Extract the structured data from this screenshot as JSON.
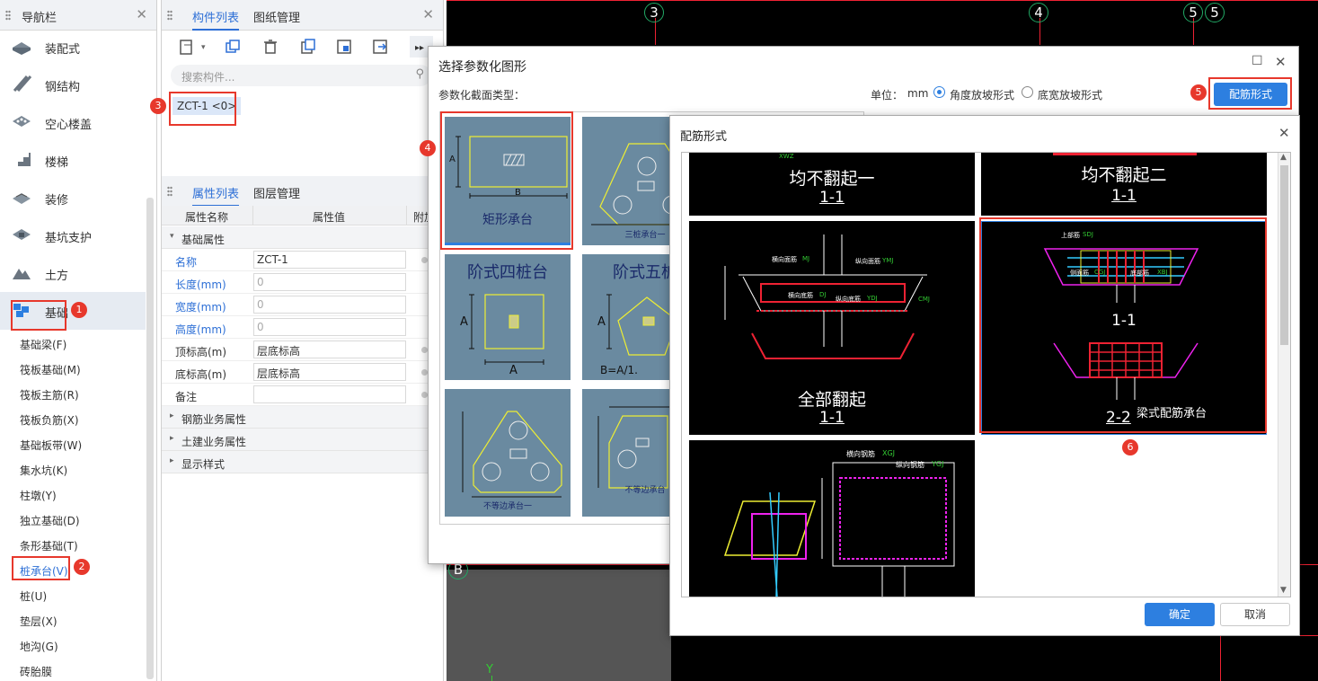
{
  "nav": {
    "title": "导航栏",
    "items": [
      {
        "label": "装配式",
        "icon": "prefab-icon"
      },
      {
        "label": "钢结构",
        "icon": "steel-beam-icon"
      },
      {
        "label": "空心楼盖",
        "icon": "hollow-slab-icon"
      },
      {
        "label": "楼梯",
        "icon": "stairs-icon"
      },
      {
        "label": "装修",
        "icon": "decoration-icon"
      },
      {
        "label": "基坑支护",
        "icon": "pit-support-icon"
      },
      {
        "label": "土方",
        "icon": "earthwork-icon"
      },
      {
        "label": "基础",
        "icon": "foundation-icon"
      }
    ],
    "subitems": [
      "基础梁(F)",
      "筏板基础(M)",
      "筏板主筋(R)",
      "筏板负筋(X)",
      "基础板带(W)",
      "集水坑(K)",
      "柱墩(Y)",
      "独立基础(D)",
      "条形基础(T)",
      "桩承台(V)",
      "桩(U)",
      "垫层(X)",
      "地沟(G)",
      "砖胎膜"
    ]
  },
  "markers": [
    "1",
    "2",
    "3",
    "4",
    "5",
    "6"
  ],
  "components": {
    "tab_active": "构件列表",
    "tab_other": "图纸管理",
    "search_placeholder": "搜索构件...",
    "item": "ZCT-1 <0>"
  },
  "props": {
    "tab_active": "属性列表",
    "tab_other": "图层管理",
    "col_name": "属性名称",
    "col_value": "属性值",
    "col_extra": "附加",
    "group_base": "基础属性",
    "rows": [
      {
        "k": "名称",
        "v": "ZCT-1",
        "blue": true
      },
      {
        "k": "长度(mm)",
        "v": "0",
        "blue": true
      },
      {
        "k": "宽度(mm)",
        "v": "0",
        "blue": true
      },
      {
        "k": "高度(mm)",
        "v": "0",
        "blue": true
      },
      {
        "k": "顶标高(m)",
        "v": "层底标高",
        "blue": false
      },
      {
        "k": "底标高(m)",
        "v": "层底标高",
        "blue": false
      },
      {
        "k": "备注",
        "v": "",
        "blue": false
      }
    ],
    "groups": [
      "钢筋业务属性",
      "土建业务属性",
      "显示样式"
    ]
  },
  "cad": {
    "axis_labels": [
      "3",
      "4",
      "5",
      "5"
    ],
    "label_b": "B",
    "label_y": "Y"
  },
  "dlg1": {
    "title": "选择参数化图形",
    "section_label": "参数化截面类型：",
    "unit_label": "单位：",
    "unit": "mm",
    "radio1": "角度放坡形式",
    "radio2": "底宽放坡形式",
    "button": "配筋形式",
    "thumbs": [
      "矩形承台",
      "三桩承台一",
      "阶式四桩台",
      "阶式五桩",
      "不等边承台一",
      "不等边承台"
    ],
    "dims": {
      "a": "A",
      "b": "B",
      "ba": "B=A/1."
    }
  },
  "dlg2": {
    "title": "配筋形式",
    "ok": "确定",
    "cancel": "取消",
    "cells": [
      {
        "name": "均不翻起一",
        "sec": "1-1"
      },
      {
        "name": "均不翻起二",
        "sec": "1-1"
      },
      {
        "name": "全部翻起",
        "sec": "1-1"
      },
      {
        "name": "梁式配筋承台",
        "sec": "1-1",
        "sec2": "2-2"
      },
      {
        "name": "",
        "sec": ""
      }
    ],
    "rebar_labels": {
      "hgj": "横向钢筋",
      "hgj_code": "XGJ",
      "zgj": "纵向钢筋",
      "zgj_code": "YGJ",
      "xwz": "XWZ",
      "hdj": "横向底筋",
      "hdj_code": "DJ",
      "zdj": "纵向底筋",
      "zdj_code": "YDJ",
      "hmj": "横向面筋",
      "hmj_code": "MJ",
      "zmj": "纵向面筋",
      "zmj_code": "YMJ",
      "sdj": "上部筋",
      "cgj": "侧面筋",
      "dbj": "底部筋",
      "cmj": "CMJ",
      "code_sdj": "SDJ",
      "code_cgj": "CGJ",
      "code_dbj": "XBJ"
    }
  }
}
